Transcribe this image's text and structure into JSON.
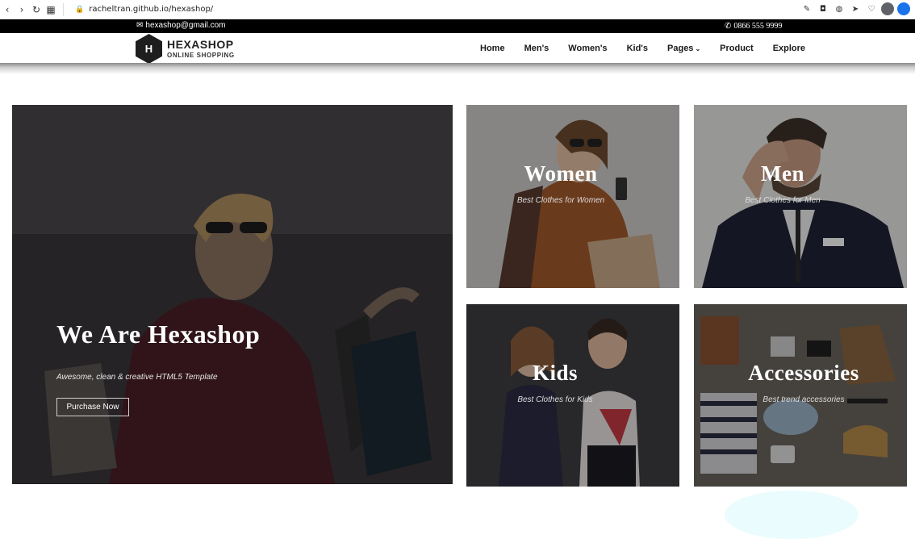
{
  "browser": {
    "url": "racheltran.github.io/hexashop/",
    "icons": [
      "back-icon",
      "forward-icon",
      "reload-icon",
      "apps-icon",
      "lock-icon"
    ]
  },
  "topbar": {
    "email": "hexashop@gmail.com",
    "phone": "0866 555 9999"
  },
  "logo": {
    "letter": "H",
    "brand": "HEXASHOP",
    "tagline": "ONLINE SHOPPING"
  },
  "nav": {
    "items": [
      "Home",
      "Men's",
      "Women's",
      "Kid's",
      "Pages",
      "Product",
      "Explore"
    ]
  },
  "hero": {
    "title": "We Are Hexashop",
    "subtitle": "Awesome, clean & creative HTML5 Template",
    "button": "Purchase Now"
  },
  "categories": {
    "women": {
      "title": "Women",
      "subtitle": "Best Clothes for Women"
    },
    "men": {
      "title": "Men",
      "subtitle": "Best Clothes for Men"
    },
    "kids": {
      "title": "Kids",
      "subtitle": "Best Clothes for Kids"
    },
    "accessories": {
      "title": "Accessories",
      "subtitle": "Best trend accessories"
    }
  }
}
